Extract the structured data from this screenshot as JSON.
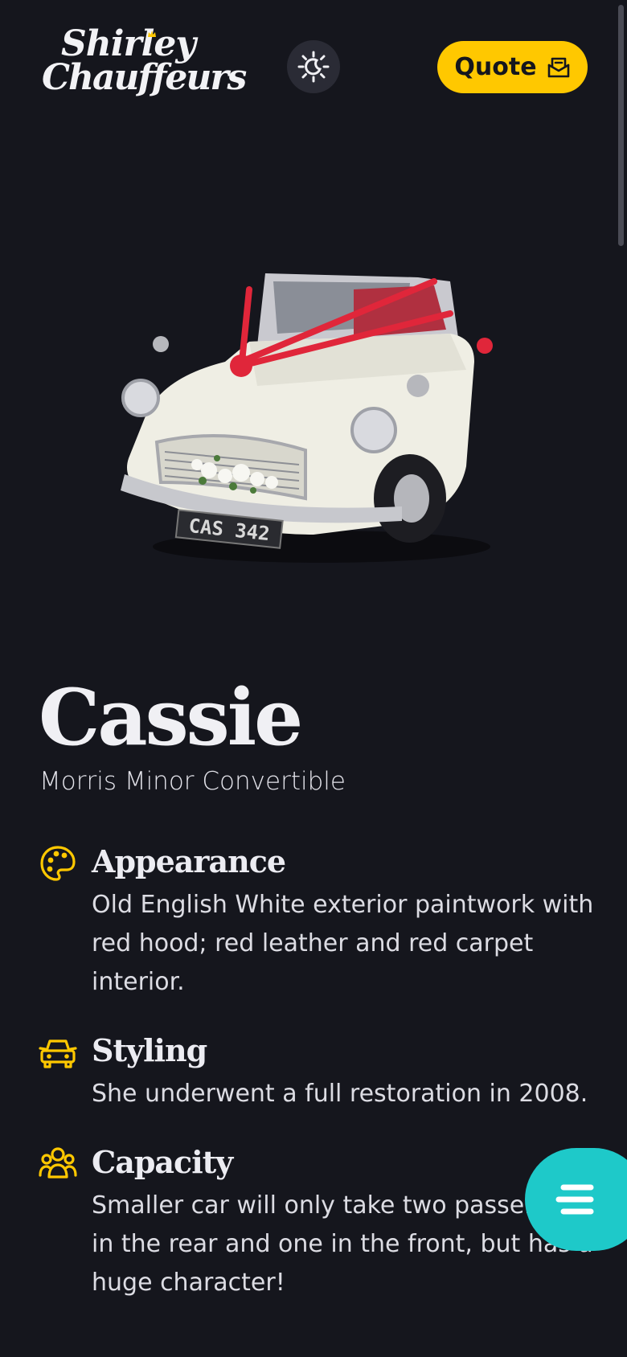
{
  "header": {
    "logo_line1": "Shirley",
    "logo_line2": "Chauffeurs",
    "quote_label": "Quote",
    "theme_icon": "sun-moon-icon",
    "quote_icon": "envelope-icon"
  },
  "car": {
    "name": "Cassie",
    "model": "Morris Minor Convertible",
    "plate": "CAS 342"
  },
  "features": [
    {
      "icon": "palette-icon",
      "heading": "Appearance",
      "text": "Old English White exterior paintwork with red hood; red leather and red carpet interior."
    },
    {
      "icon": "car-icon",
      "heading": "Styling",
      "text": "She underwent a full restoration in 2008."
    },
    {
      "icon": "people-icon",
      "heading": "Capacity",
      "text": "Smaller car will only take two passengers in the rear and one in the front, but has a huge character!"
    }
  ],
  "menu_icon": "hamburger-icon",
  "colors": {
    "background": "#15161d",
    "accent_yellow": "#ffc800",
    "accent_teal": "#1ec9c9"
  }
}
